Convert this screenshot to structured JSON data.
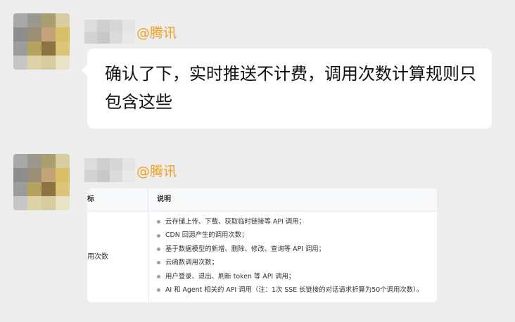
{
  "messages": [
    {
      "sender": {
        "name_suffix": "@腾讯"
      },
      "type": "text",
      "text": "确认了下，实时推送不计费，调用次数计算规则只包含这些"
    },
    {
      "sender": {
        "name_suffix": "@腾讯"
      },
      "type": "image",
      "table": {
        "header": {
          "col1": "标",
          "col2": "说明"
        },
        "row_label": "用次数",
        "items": [
          "云存储上传、下载、获取临时链接等 API 调用；",
          "CDN 回源产生的调用次数；",
          "基于数据模型的新增、删除、修改、查询等 API 调用；",
          "云函数调用次数；",
          "用户登录、退出、刷新 token 等 API 调用；",
          "AI 和 Agent 相关的 API 调用（注：1次 SSE 长链接的对话请求折算为50个调用次数）。"
        ]
      }
    }
  ],
  "colors": {
    "background": "#ededed",
    "bubble": "#ffffff",
    "sender_tag": "#f0a020",
    "text": "#111111"
  }
}
